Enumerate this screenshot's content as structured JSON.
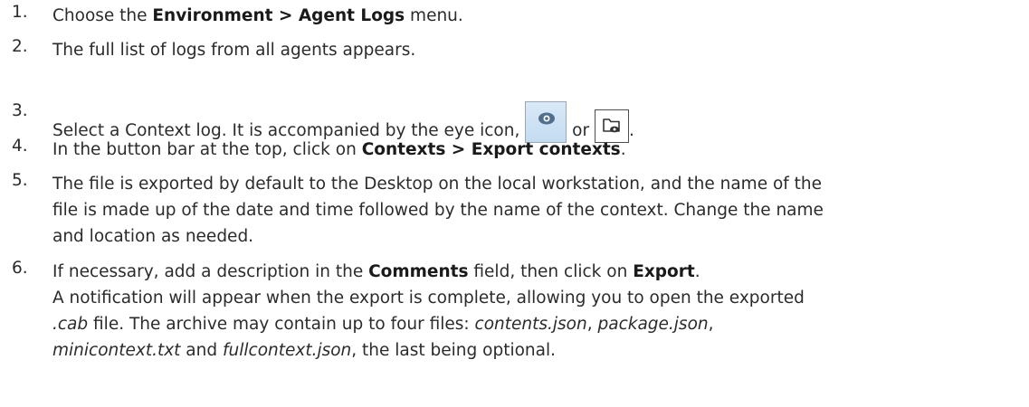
{
  "steps": [
    {
      "number": "1.",
      "pre": "Choose the ",
      "bold1": "Environment > Agent Logs",
      "post": " menu."
    },
    {
      "number": "2.",
      "text": "The full list of logs from all agents appears."
    },
    {
      "number": "3.",
      "pre": "Select a Context log. It is accompanied by the eye icon,",
      "icon1": "eye-icon",
      "mid": " or ",
      "icon2": "folder-eye-icon",
      "post": "."
    },
    {
      "number": "4.",
      "pre": "In the button bar at the top, click on ",
      "bold1": "Contexts > Export contexts",
      "post": "."
    },
    {
      "number": "5.",
      "line1": "The file is exported by default to the Desktop on the local workstation, and the name of the",
      "line2": "file is made up of the date and time followed by the name of the context. Change the name",
      "line3": "and location as needed."
    },
    {
      "number": "6.",
      "l1_pre": "If necessary, add a description in the ",
      "l1_bold1": "Comments",
      "l1_mid": " field, then click on ",
      "l1_bold2": "Export",
      "l1_post": ".",
      "l2": "A notification will appear when the export is complete, allowing you to open the exported",
      "l3_pre": " ",
      "l3_ital": ".cab",
      "l3_post": " file. The archive may contain up to four files: ",
      "l3_f1": "contents.json",
      "l3_sep1": ", ",
      "l3_f2": "package.json",
      "l3_sep2": ",",
      "l4_f3": "minicontext.txt",
      "l4_and": " and ",
      "l4_f4": "fullcontext.json",
      "l4_post": ", the last being optional."
    }
  ],
  "colors": {
    "text": "#2b2b2b",
    "eye_button_bg": "#c4dcf1",
    "eye_icon": "#4f6f8c"
  }
}
